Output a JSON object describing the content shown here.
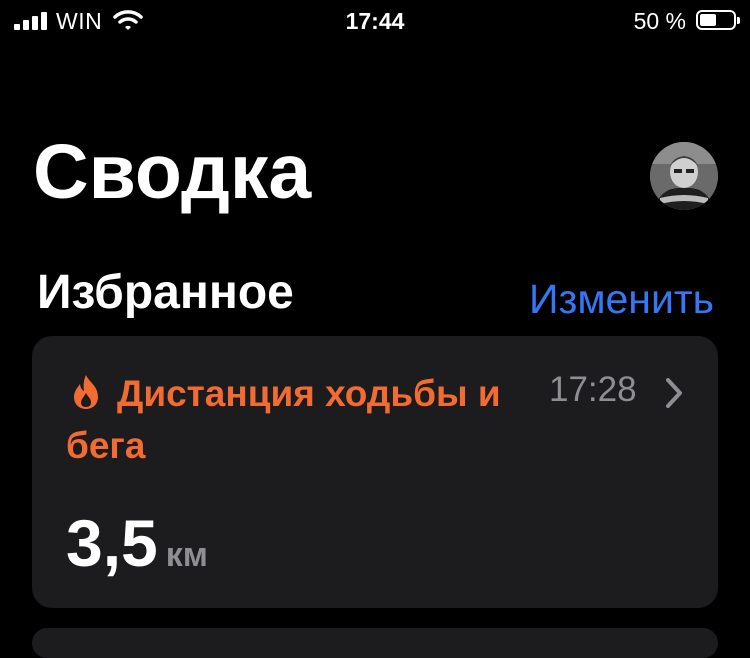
{
  "status_bar": {
    "carrier": "WIN",
    "time": "17:44",
    "battery_percent": "50 %",
    "battery_level": 0.5,
    "icons": [
      "signal-icon",
      "wifi-icon",
      "battery-icon"
    ]
  },
  "header": {
    "title": "Сводка",
    "avatar": "profile-avatar"
  },
  "favorites": {
    "title": "Избранное",
    "edit_label": "Изменить"
  },
  "card": {
    "icon": "flame-icon",
    "title": "Дистанция ходьбы и бега",
    "time": "17:28",
    "value": "3,5",
    "unit": "км",
    "title_color": "#f26b33"
  },
  "colors": {
    "accent": "#3478f6",
    "card_background": "#1c1c1e",
    "secondary_text": "#8e8e93"
  }
}
